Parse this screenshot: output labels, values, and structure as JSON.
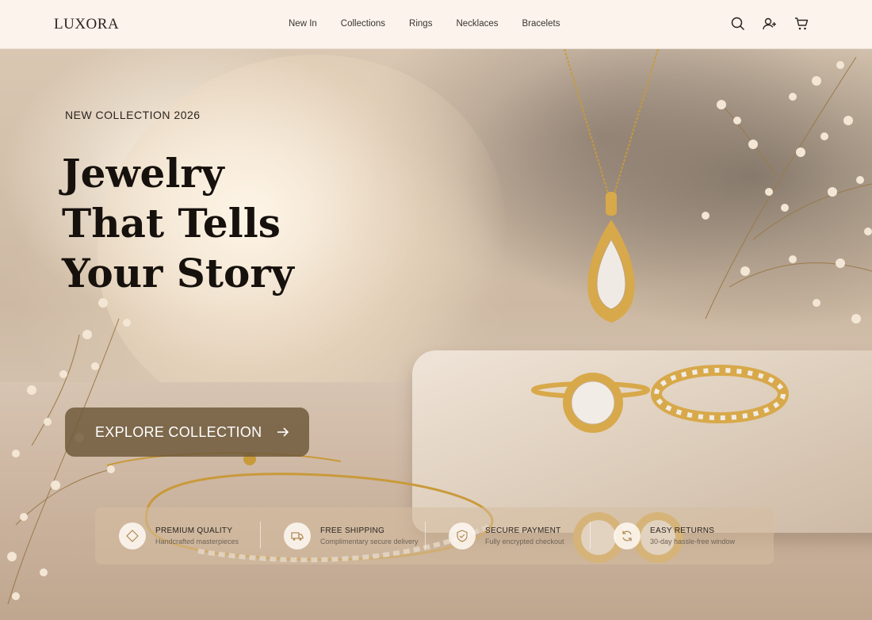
{
  "brand": "LUXORA",
  "nav": [
    "New In",
    "Collections",
    "Rings",
    "Necklaces",
    "Bracelets"
  ],
  "header_icons": [
    "search-icon",
    "add-user-icon",
    "cart-icon"
  ],
  "hero": {
    "eyebrow": "NEW COLLECTION 2026",
    "headline_lines": [
      "Jewelry",
      "That Tells",
      "Your Story"
    ],
    "cta_label": "EXPLORE COLLECTION"
  },
  "features": [
    {
      "icon": "diamond-icon",
      "title": "PREMIUM QUALITY",
      "subtitle": "Handcrafted masterpieces"
    },
    {
      "icon": "truck-icon",
      "title": "FREE SHIPPING",
      "subtitle": "Complimentary secure delivery"
    },
    {
      "icon": "shield-icon",
      "title": "SECURE PAYMENT",
      "subtitle": "Fully encrypted checkout"
    },
    {
      "icon": "refresh-icon",
      "title": "EASY RETURNS",
      "subtitle": "30-day hassle-free window"
    }
  ],
  "colors": {
    "header_bg": "#fbf3ec",
    "text_dark": "#16110d",
    "cta_bg": "#705a3c",
    "gold": "#c99a3a"
  }
}
